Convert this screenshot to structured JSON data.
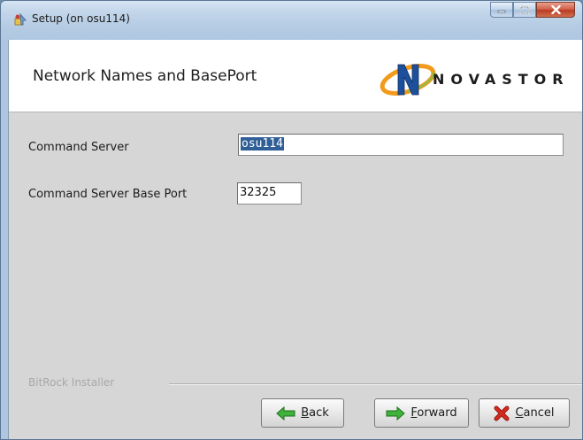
{
  "window": {
    "title": "Setup (on osu114)",
    "minimize_icon": "minimize-icon",
    "maximize_icon": "maximize-icon",
    "close_icon": "close-icon"
  },
  "header": {
    "title": "Network Names and BasePort",
    "logo_text": "NOVASTOR"
  },
  "form": {
    "command_server_label": "Command Server",
    "command_server_value": "osu114",
    "base_port_label": "Command Server Base Port",
    "base_port_value": "32325"
  },
  "footer": {
    "group_label": "BitRock Installer",
    "back_label": "Back",
    "forward_label": "Forward",
    "cancel_label": "Cancel"
  },
  "colors": {
    "selection": "#2f5f96",
    "arrow_green": "#3fb23a",
    "cancel_red": "#d42a1f",
    "logo_orange": "#f39a1c",
    "logo_blue": "#1d4f9b",
    "logo_green": "#7fc24b"
  }
}
